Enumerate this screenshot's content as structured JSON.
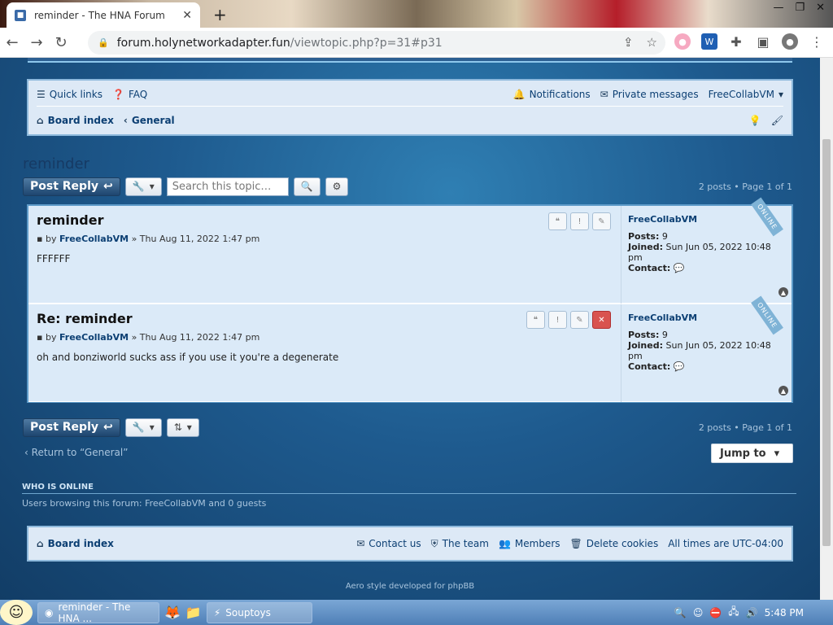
{
  "browser": {
    "tab_title": "reminder - The HNA Forum",
    "url_host": "forum.holynetworkadapter.fun",
    "url_path": "/viewtopic.php?p=31#p31"
  },
  "nav": {
    "quick_links": "Quick links",
    "faq": "FAQ",
    "notifications": "Notifications",
    "private_messages": "Private messages",
    "username": "FreeCollabVM",
    "board_index": "Board index",
    "crumb_general": "General"
  },
  "topic": {
    "title": "reminder",
    "post_reply": "Post Reply",
    "search_placeholder": "Search this topic…",
    "page_info_top": "2 posts • Page 1 of 1",
    "page_info_bottom": "2 posts • Page 1 of 1"
  },
  "posts": [
    {
      "title": "reminder",
      "by": "by",
      "author": "FreeCollabVM",
      "date": "» Thu Aug 11, 2022 1:47 pm",
      "body": "FFFFFF",
      "status": "ONLINE",
      "profile_name": "FreeCollabVM",
      "posts_label": "Posts:",
      "posts_count": "9",
      "joined_label": "Joined:",
      "joined": "Sun Jun 05, 2022 10:48 pm",
      "contact_label": "Contact:"
    },
    {
      "title": "Re: reminder",
      "by": "by",
      "author": "FreeCollabVM",
      "date": "» Thu Aug 11, 2022 1:47 pm",
      "body": "oh and bonziworld sucks ass if you use it you're a degenerate",
      "status": "ONLINE",
      "profile_name": "FreeCollabVM",
      "posts_label": "Posts:",
      "posts_count": "9",
      "joined_label": "Joined:",
      "joined": "Sun Jun 05, 2022 10:48 pm",
      "contact_label": "Contact:"
    }
  ],
  "bottom": {
    "return_link": "Return to “General”",
    "jump_to": "Jump to",
    "who_is_online": "WHO IS ONLINE",
    "browsing": "Users browsing this forum: FreeCollabVM and 0 guests"
  },
  "footer": {
    "board_index": "Board index",
    "contact_us": "Contact us",
    "the_team": "The team",
    "members": "Members",
    "delete_cookies": "Delete cookies",
    "timezone": "All times are UTC-04:00",
    "credit": "Aero style developed for phpBB"
  },
  "taskbar": {
    "task_chrome": "reminder - The HNA ...",
    "task_souptoys": "Souptoys",
    "clock": "5:48 PM"
  }
}
